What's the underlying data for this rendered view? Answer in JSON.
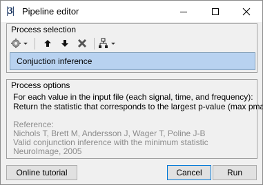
{
  "window": {
    "title": "Pipeline editor",
    "app_icon_text": "|3|"
  },
  "process_selection": {
    "title": "Process selection",
    "toolbar": {
      "settings_icon": "gear-icon",
      "up_icon": "arrow-up-icon",
      "down_icon": "arrow-down-icon",
      "delete_icon": "delete-x-icon",
      "pipeline_icon": "tree-icon"
    },
    "items": [
      {
        "label": "Conjuction inference",
        "selected": true
      }
    ]
  },
  "process_options": {
    "title": "Process options",
    "description_lines": [
      "For each value in the input file (each signal, time, and frequency):",
      "Return the statistic that corresponds to the largest p-value (max pmap)."
    ],
    "reference_lines": [
      "Reference:",
      "Nichols T, Brett M, Andersson J, Wager T, Poline J-B",
      "Valid conjunction inference with the minimum statistic",
      "NeuroImage, 2005"
    ]
  },
  "buttons": {
    "tutorial": "Online tutorial",
    "cancel": "Cancel",
    "run": "Run"
  },
  "colors": {
    "selection": "#b8d2f0",
    "reference_text": "#8c8c8c",
    "default_button_border": "#0078d7"
  }
}
